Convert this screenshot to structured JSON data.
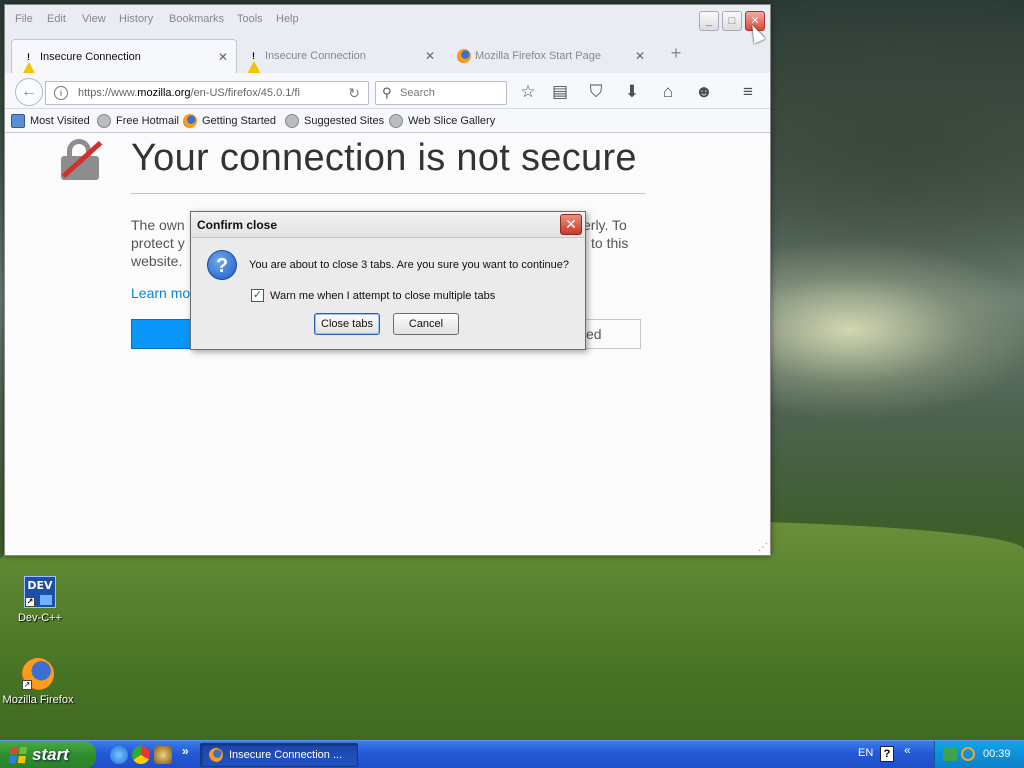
{
  "desktop": {
    "icons": [
      {
        "label": "Dev-C++",
        "badge": "DEV",
        "icon": "devcpp-icon"
      },
      {
        "label": "Mozilla Firefox",
        "icon": "firefox-icon"
      }
    ]
  },
  "firefox": {
    "menubar": [
      "File",
      "Edit",
      "View",
      "History",
      "Bookmarks",
      "Tools",
      "Help"
    ],
    "window_controls": {
      "minimize": "_",
      "maximize": "□",
      "close": "✕"
    },
    "tabs": [
      {
        "label": "Insecure Connection",
        "icon": "warning-icon",
        "active": true
      },
      {
        "label": "Insecure Connection",
        "icon": "warning-icon",
        "active": false
      },
      {
        "label": "Mozilla Firefox Start Page",
        "icon": "firefox-icon",
        "active": false
      }
    ],
    "tab_close_glyph": "✕",
    "new_tab_glyph": "+",
    "url": {
      "prefix": "https://www.",
      "domain": "mozilla.org",
      "path": "/en-US/firefox/45.0.1/fi"
    },
    "search_placeholder": "Search",
    "toolbar_icons": [
      "bookmark-star-icon",
      "reading-list-icon",
      "pocket-icon",
      "download-icon",
      "home-icon",
      "hello-icon",
      "menu-icon"
    ],
    "bookmarks": [
      {
        "label": "Most Visited",
        "icon": "most-visited-icon"
      },
      {
        "label": "Free Hotmail",
        "icon": "globe-icon"
      },
      {
        "label": "Getting Started",
        "icon": "firefox-icon"
      },
      {
        "label": "Suggested Sites",
        "icon": "globe-icon"
      },
      {
        "label": "Web Slice Gallery",
        "icon": "globe-icon"
      }
    ],
    "error_page": {
      "title": "Your connection is not secure",
      "text_left_line1": "The own",
      "text_left_line2": "protect y",
      "text_left_line3": "website.",
      "text_right_line1": "erly. To",
      "text_right_line2": "to this",
      "learn_more": "Learn mo",
      "advanced_partial": "ed"
    }
  },
  "dialog": {
    "title": "Confirm close",
    "message": "You are about to close 3 tabs. Are you sure you want to continue?",
    "checkbox_label": "Warn me when I attempt to close multiple tabs",
    "checkbox_checked": true,
    "confirm_label": "Close tabs",
    "cancel_label": "Cancel",
    "close_glyph": "✕"
  },
  "taskbar": {
    "start_label": "start",
    "quick_launch": [
      "internet-explorer-icon",
      "chrome-icon",
      "misc-app-icon"
    ],
    "more_glyph": "»",
    "task_item": "Insecure Connection ...",
    "language": "EN",
    "help_glyph": "?",
    "tray_arrow": "«",
    "clock": "00:39"
  }
}
